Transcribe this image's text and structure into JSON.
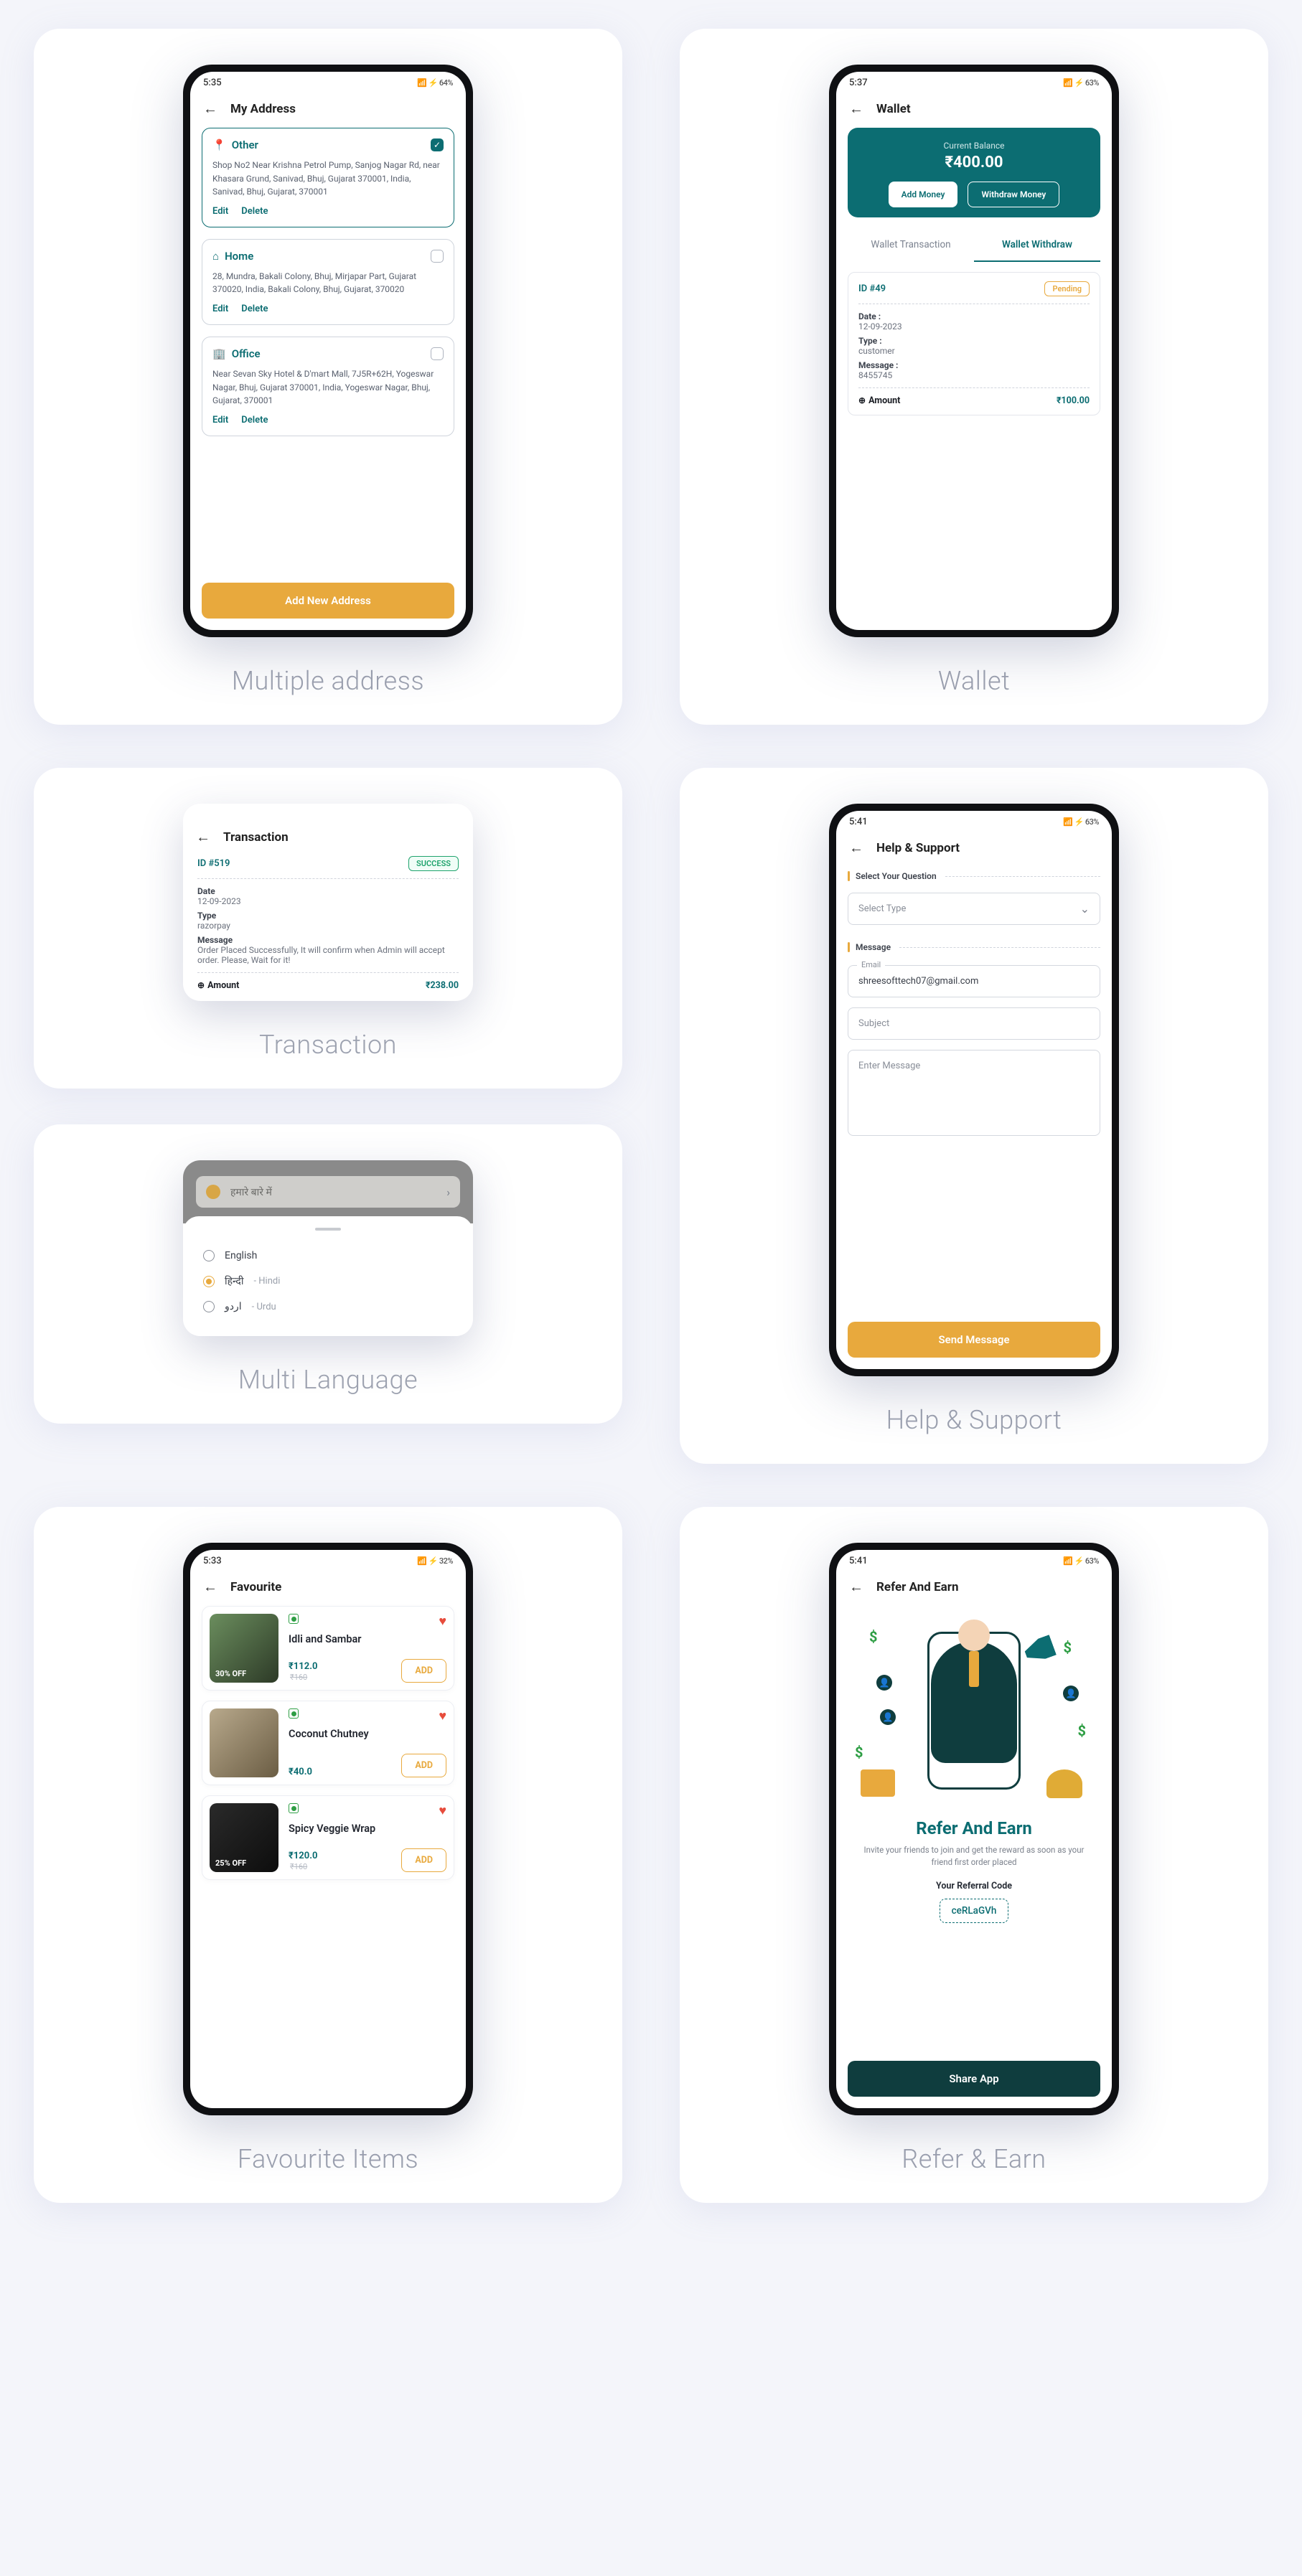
{
  "address": {
    "time": "5:35",
    "status_icons": "📶 ⚡ 64%",
    "title": "My Address",
    "cards": [
      {
        "icon": "📍",
        "name": "Other",
        "selected": true,
        "text": "Shop No2 Near Krishna Petrol Pump, Sanjog Nagar Rd, near Khasara Grund, Sanivad, Bhuj, Gujarat 370001, India, Sanivad, Bhuj, Gujarat, 370001"
      },
      {
        "icon": "⌂",
        "name": "Home",
        "selected": false,
        "text": "28, Mundra, Bakali Colony, Bhuj, Mirjapar Part, Gujarat 370020, India, Bakali Colony, Bhuj, Gujarat, 370020"
      },
      {
        "icon": "🏢",
        "name": "Office",
        "selected": false,
        "text": "Near Sevan Sky Hotel & D'mart Mall, 7J5R+62H, Yogeswar Nagar, Bhuj, Gujarat 370001, India, Yogeswar Nagar, Bhuj, Gujarat, 370001"
      }
    ],
    "edit": "Edit",
    "delete": "Delete",
    "add_btn": "Add New Address",
    "caption": "Multiple address"
  },
  "wallet": {
    "time": "5:37",
    "status_icons": "📶 ⚡ 63%",
    "title": "Wallet",
    "balance_lbl": "Current Balance",
    "balance": "₹400.00",
    "add": "Add Money",
    "withdraw": "Withdraw Money",
    "tab1": "Wallet Transaction",
    "tab2": "Wallet Withdraw",
    "wid": "ID #49",
    "badge": "Pending",
    "date_k": "Date :",
    "date_v": "12-09-2023",
    "type_k": "Type :",
    "type_v": "customer",
    "msg_k": "Message :",
    "msg_v": "8455745",
    "amount_k": "Amount",
    "amount_v": "₹100.00",
    "caption": "Wallet"
  },
  "tx": {
    "title": "Transaction",
    "id": "ID #519",
    "badge": "SUCCESS",
    "date_k": "Date",
    "date_v": "12-09-2023",
    "type_k": "Type",
    "type_v": "razorpay",
    "msg_k": "Message",
    "msg_v": "Order Placed Successfully, It will confirm when Admin will accept order. Please, Wait for it!",
    "amount_k": "Amount",
    "amount_v": "₹238.00",
    "caption": "Transaction"
  },
  "ml": {
    "top_item": "हमारे बारे में",
    "langs": [
      {
        "label": "English",
        "sub": "",
        "sel": false
      },
      {
        "label": "हिन्दी",
        "sub": "- Hindi",
        "sel": true
      },
      {
        "label": "اردو",
        "sub": "- Urdu",
        "sel": false
      }
    ],
    "caption": "Multi Language"
  },
  "hs": {
    "time": "5:41",
    "status_icons": "📶 ⚡ 63%",
    "title": "Help & Support",
    "q_head": "Select Your Question",
    "select": "Select Type",
    "m_head": "Message",
    "email_lbl": "Email",
    "email": "shreesofttech07@gmail.com",
    "subject": "Subject",
    "enter": "Enter Message",
    "send": "Send Message",
    "caption": "Help & Support"
  },
  "fav": {
    "time": "5:33",
    "status_icons": "📶 ⚡ 32%",
    "title": "Favourite",
    "items": [
      {
        "name": "Idli and Sambar",
        "price": "₹112.0",
        "old": "₹160",
        "badge": "30% OFF"
      },
      {
        "name": "Coconut Chutney",
        "price": "₹40.0",
        "old": "",
        "badge": ""
      },
      {
        "name": "Spicy Veggie Wrap",
        "price": "₹120.0",
        "old": "₹160",
        "badge": "25% OFF"
      }
    ],
    "add": "ADD",
    "caption": "Favourite Items"
  },
  "refer": {
    "time": "5:41",
    "status_icons": "📶 ⚡ 63%",
    "title": "Refer And Earn",
    "h": "Refer And Earn",
    "sub": "Invite your friends to join and get the reward as soon as your friend first order placed",
    "lbl": "Your Referral Code",
    "code": "ceRLaGVh",
    "share": "Share App",
    "caption": "Refer & Earn"
  },
  "labels": {
    "amount_sym": "⊕"
  }
}
